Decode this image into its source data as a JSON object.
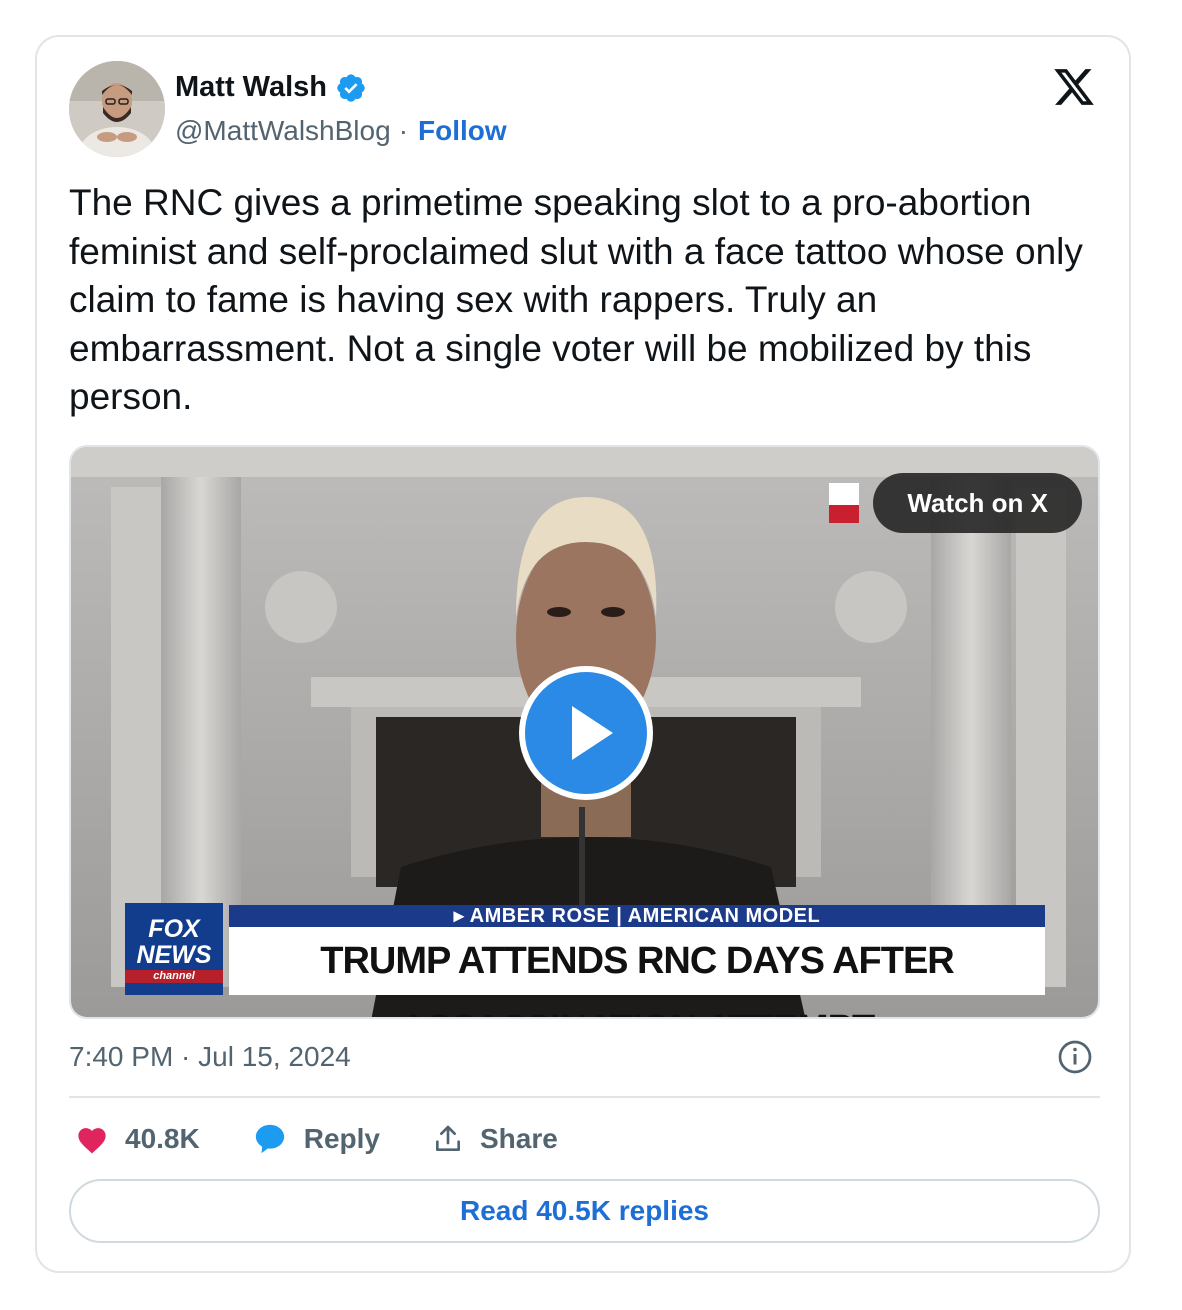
{
  "author": {
    "name": "Matt Walsh",
    "handle": "@MattWalshBlog",
    "separator": "·",
    "follow_label": "Follow",
    "verified": true
  },
  "tweet": {
    "text": "The RNC gives a primetime speaking slot to a pro-abortion feminist and self-proclaimed slut with a face tattoo whose only claim to fame is having sex with rappers. Truly an embarrassment. Not a single voter will be mobilized by this person."
  },
  "media": {
    "watch_label": "Watch on X",
    "chyron_top": "▸ AMBER ROSE | AMERICAN MODEL",
    "chyron_main": "TRUMP ATTENDS RNC DAYS AFTER ASSASSINATION ATTEMPT",
    "network_logo_line1": "FOX",
    "network_logo_line2": "NEWS",
    "network_logo_line3": "channel"
  },
  "meta": {
    "timestamp": "7:40 PM · Jul 15, 2024"
  },
  "actions": {
    "likes": "40.8K",
    "reply_label": "Reply",
    "share_label": "Share"
  },
  "replies_button": {
    "label": "Read 40.5K replies"
  },
  "colors": {
    "link_blue": "#1d6fd6",
    "like_pink": "#e0245e",
    "reply_blue": "#1d9bf0",
    "verified_blue": "#1d9bf0",
    "secondary_text": "#536471"
  },
  "icons": {
    "brand": "x-logo-icon",
    "verified": "verified-badge-icon",
    "like": "heart-icon",
    "reply": "speech-bubble-icon",
    "share": "share-upload-icon",
    "info": "info-icon",
    "play": "play-icon"
  }
}
